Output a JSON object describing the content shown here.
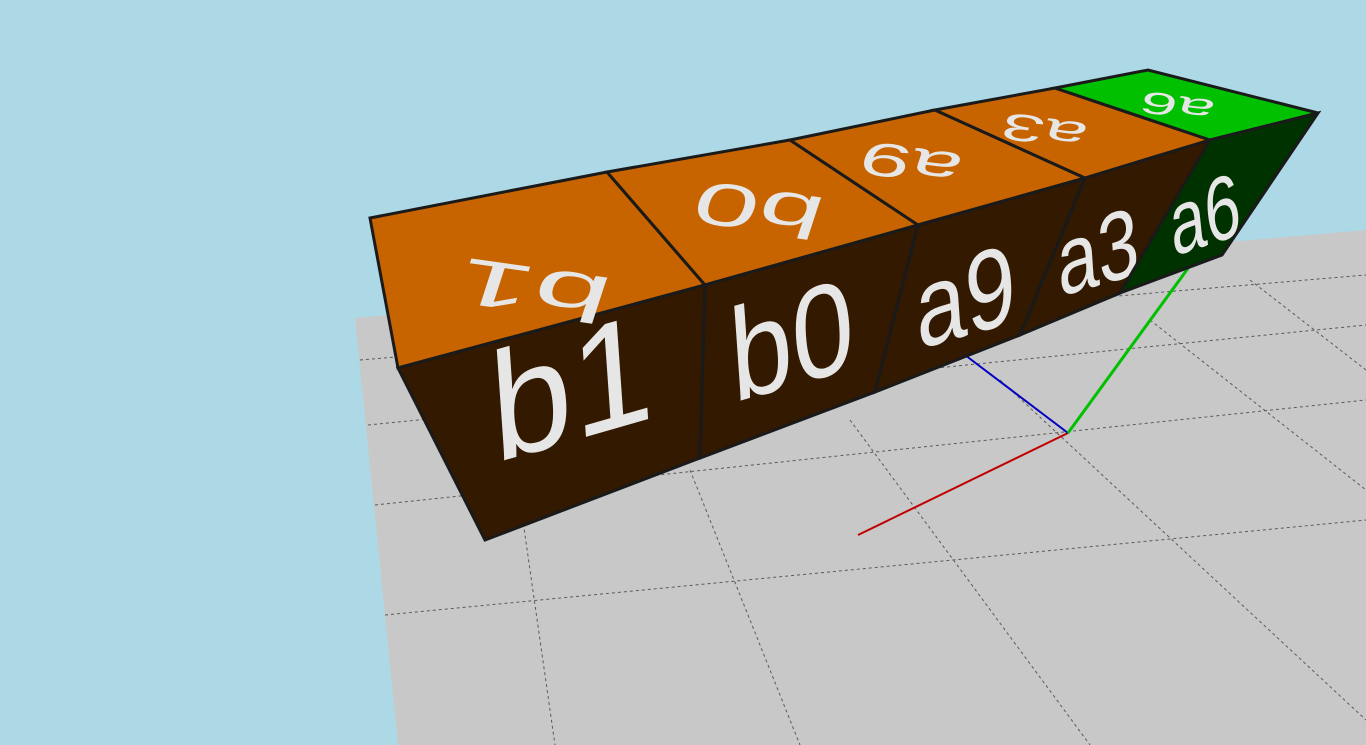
{
  "scene": {
    "background_color": "#add8e6",
    "floor_color": "#c8c8c8",
    "floor_grid_color": "#5a5a5a",
    "axis_colors": {
      "x": "#c00000",
      "y": "#00c000",
      "z": "#0000c0"
    }
  },
  "cubes": [
    {
      "label": "b1",
      "top_color": "#c86400",
      "side_color": "#321900"
    },
    {
      "label": "b0",
      "top_color": "#c86400",
      "side_color": "#321900"
    },
    {
      "label": "a9",
      "top_color": "#c86400",
      "side_color": "#321900"
    },
    {
      "label": "a3",
      "top_color": "#c86400",
      "side_color": "#321900"
    },
    {
      "label": "a6",
      "top_color": "#00c000",
      "side_color": "#003200"
    }
  ],
  "label_color": "#e6e6e6"
}
